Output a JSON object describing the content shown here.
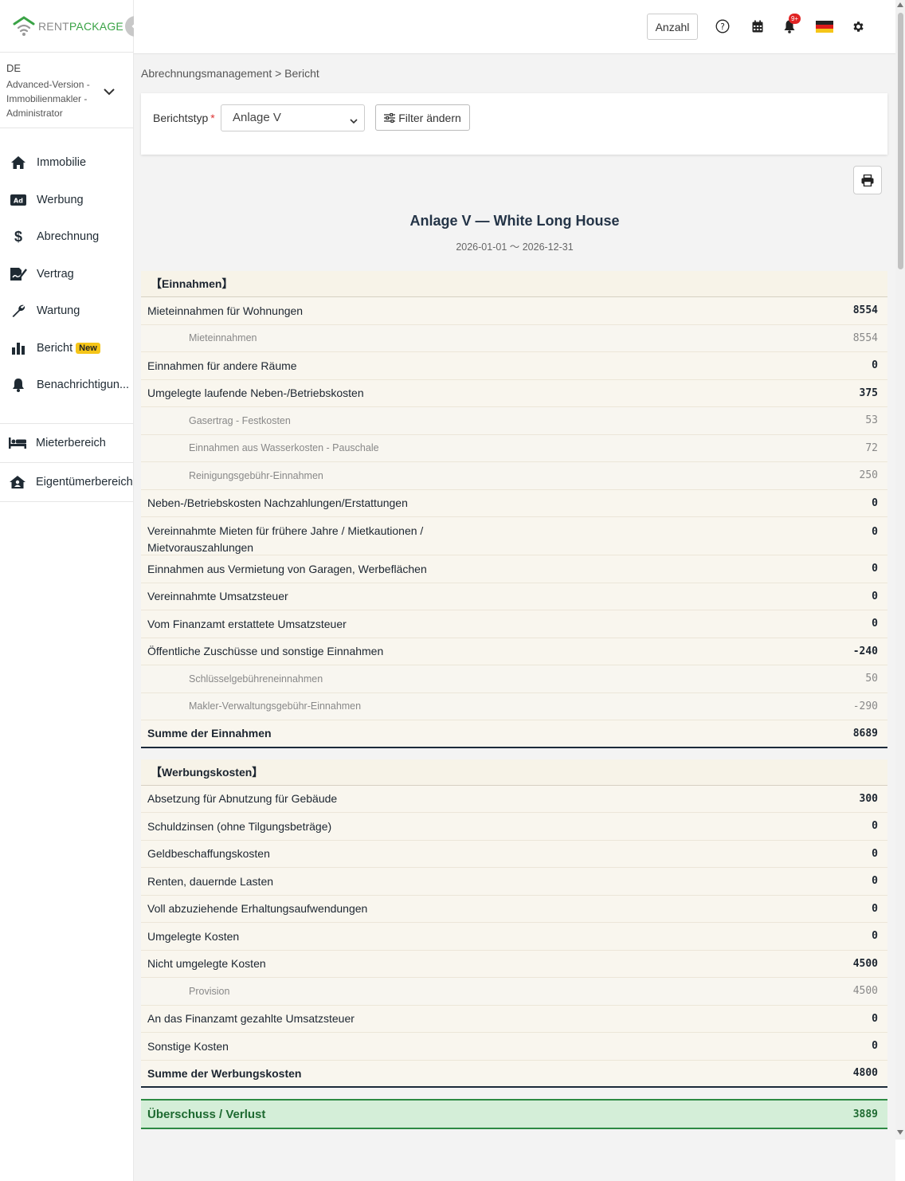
{
  "app": {
    "logo_rent": "RENT",
    "logo_package": "PACKAGE",
    "brand_color": "#3aa346"
  },
  "account": {
    "lang": "DE",
    "role": "Advanced-Version - Immobilienmakler - Administrator"
  },
  "nav": {
    "items": [
      {
        "label": "Immobilie",
        "icon": "home-icon"
      },
      {
        "label": "Werbung",
        "icon": "ad-icon"
      },
      {
        "label": "Abrechnung",
        "icon": "dollar-icon"
      },
      {
        "label": "Vertrag",
        "icon": "contract-icon"
      },
      {
        "label": "Wartung",
        "icon": "wrench-icon"
      },
      {
        "label": "Bericht",
        "icon": "bar-chart-icon",
        "badge": "New"
      },
      {
        "label": "Benachrichtigun...",
        "icon": "bell-icon"
      }
    ],
    "areas": [
      {
        "label": "Mieterbereich",
        "icon": "bed-icon"
      },
      {
        "label": "Eigentümerbereich",
        "icon": "house-user-icon"
      }
    ]
  },
  "header": {
    "anzahl_label": "Anzahl",
    "notification_count": "9+"
  },
  "breadcrumb": "Abrechnungsmanagement > Bericht",
  "filter": {
    "label": "Berichtstyp",
    "required_mark": "*",
    "selected": "Anlage V",
    "change_label": "Filter ändern"
  },
  "report": {
    "title": "Anlage V — White Long House",
    "range": "2026-01-01 〜 2026-12-31",
    "income": {
      "heading": "【Einnahmen】",
      "rows": [
        {
          "label": "Mieteinnahmen für Wohnungen",
          "value": "8554"
        },
        {
          "label": "Mieteinnahmen",
          "value": "8554",
          "sub": true
        },
        {
          "label": "Einnahmen für andere Räume",
          "value": "0"
        },
        {
          "label": "Umgelegte laufende Neben-/Betriebskosten",
          "value": "375"
        },
        {
          "label": "Gasertrag - Festkosten",
          "value": "53",
          "sub": true
        },
        {
          "label": "Einnahmen aus Wasserkosten - Pauschale",
          "value": "72",
          "sub": true
        },
        {
          "label": "Reinigungsgebühr-Einnahmen",
          "value": "250",
          "sub": true
        },
        {
          "label": "Neben-/Betriebskosten Nachzahlungen/Erstattungen",
          "value": "0"
        },
        {
          "label": "Vereinnahmte Mieten für frühere Jahre / Mietkautionen / Mietvorauszahlungen",
          "value": "0",
          "tall": true
        },
        {
          "label": "Einnahmen aus Vermietung von Garagen, Werbeflächen",
          "value": "0"
        },
        {
          "label": "Vereinnahmte Umsatzsteuer",
          "value": "0"
        },
        {
          "label": "Vom Finanzamt erstattete Umsatzsteuer",
          "value": "0"
        },
        {
          "label": "Öffentliche Zuschüsse und sonstige Einnahmen",
          "value": "-240"
        },
        {
          "label": "Schlüsselgebühreneinnahmen",
          "value": "50",
          "sub": true
        },
        {
          "label": "Makler-Verwaltungsgebühr-Einnahmen",
          "value": "-290",
          "sub": true
        }
      ],
      "sum_label": "Summe der Einnahmen",
      "sum_value": "8689"
    },
    "expenses": {
      "heading": "【Werbungskosten】",
      "rows": [
        {
          "label": "Absetzung für Abnutzung für Gebäude",
          "value": "300"
        },
        {
          "label": "Schuldzinsen (ohne Tilgungsbeträge)",
          "value": "0"
        },
        {
          "label": "Geldbeschaffungskosten",
          "value": "0"
        },
        {
          "label": "Renten, dauernde Lasten",
          "value": "0"
        },
        {
          "label": "Voll abzuziehende Erhaltungsaufwendungen",
          "value": "0"
        },
        {
          "label": "Umgelegte Kosten",
          "value": "0"
        },
        {
          "label": "Nicht umgelegte Kosten",
          "value": "4500"
        },
        {
          "label": "Provision",
          "value": "4500",
          "sub": true
        },
        {
          "label": "An das Finanzamt gezahlte Umsatzsteuer",
          "value": "0"
        },
        {
          "label": "Sonstige Kosten",
          "value": "0"
        }
      ],
      "sum_label": "Summe der Werbungskosten",
      "sum_value": "4800"
    },
    "result_label": "Überschuss / Verlust",
    "result_value": "3889"
  }
}
